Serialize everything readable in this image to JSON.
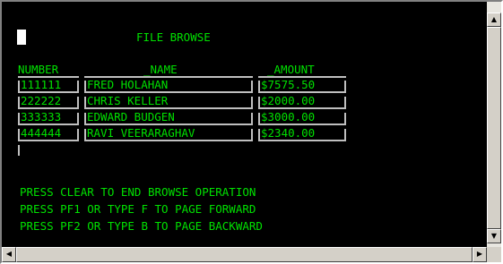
{
  "screen": {
    "title": "FILE BROWSE",
    "columns": {
      "number": "NUMBER",
      "name": "_NAME",
      "amount": "_AMOUNT"
    },
    "rows": [
      {
        "number": "111111",
        "name": "FRED HOLAHAN",
        "amount": "$7575.50"
      },
      {
        "number": "222222",
        "name": "CHRIS KELLER",
        "amount": "$2000.00"
      },
      {
        "number": "333333",
        "name": "EDWARD BUDGEN",
        "amount": "$3000.00"
      },
      {
        "number": "444444",
        "name": "RAVI VEERARAGHAV",
        "amount": "$2340.00"
      }
    ],
    "instructions": [
      "PRESS CLEAR TO END BROWSE OPERATION",
      "PRESS PF1 OR TYPE F TO PAGE FORWARD",
      "PRESS PF2 OR TYPE B TO PAGE BACKWARD"
    ]
  },
  "scrollbars": {
    "up_icon": "triangle-up-icon",
    "down_icon": "triangle-down-icon",
    "left_icon": "triangle-left-icon",
    "right_icon": "triangle-right-icon"
  },
  "colors": {
    "screen_bg": "#000000",
    "text_green": "#00e000",
    "field_border": "#bfbfbf",
    "cursor": "#ffffff"
  }
}
